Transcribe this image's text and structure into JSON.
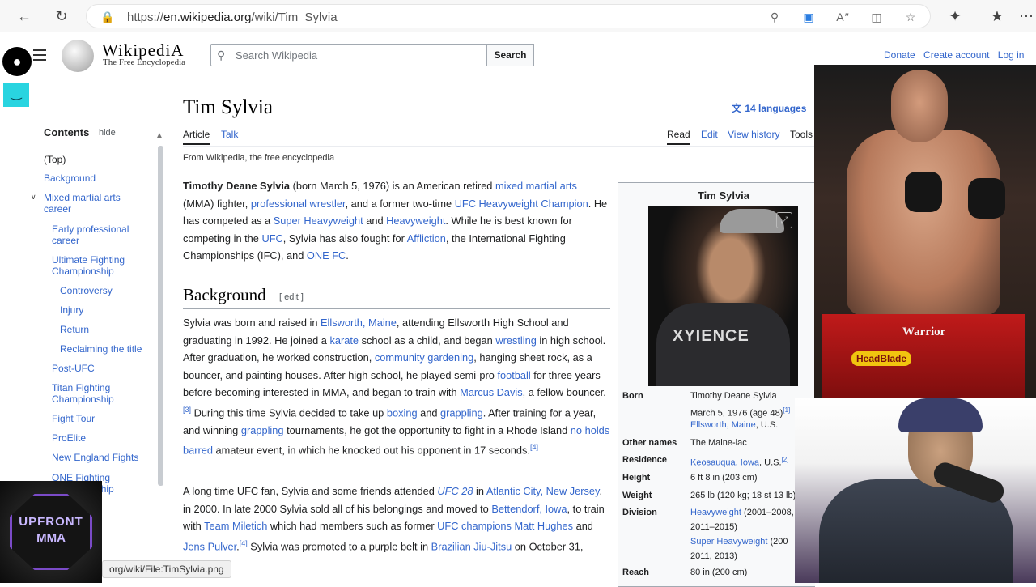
{
  "browser": {
    "url_prefix": "https://",
    "url_host": "en.wikipedia.org",
    "url_path": "/wiki/Tim_Sylvia"
  },
  "wiki": {
    "wordmark": "WikipediA",
    "tagline": "The Free Encyclopedia",
    "search_placeholder": "Search Wikipedia",
    "search_button": "Search",
    "donate": "Donate",
    "create_account": "Create account",
    "login": "Log in",
    "more": "••"
  },
  "toc": {
    "title": "Contents",
    "hide": "hide",
    "items": [
      "(Top)",
      "Background",
      "Mixed martial arts career",
      "Early professional career",
      "Ultimate Fighting Championship",
      "Controversy",
      "Injury",
      "Return",
      "Reclaiming the title",
      "Post-UFC",
      "Titan Fighting Championship",
      "Fight Tour",
      "ProElite",
      "New England Fights",
      "ONE Fighting Championship"
    ]
  },
  "article": {
    "title": "Tim Sylvia",
    "languages": "14 languages",
    "tabs": [
      "Article",
      "Talk"
    ],
    "actions": [
      "Read",
      "Edit",
      "View history",
      "Tools"
    ],
    "from": "From Wikipedia, the free encyclopedia",
    "bg_heading": "Background",
    "bg_edit": "[ edit ]"
  },
  "infobox": {
    "title": "Tim Sylvia",
    "born_label": "Born",
    "born_name": "Timothy Deane Sylvia",
    "born_date": "March 5, 1976 (age 48)",
    "born_ref": "[1]",
    "born_place": "Ellsworth, Maine",
    "born_place_suffix": ", U.S.",
    "other_label": "Other names",
    "other_val": "The Maine-iac",
    "res_label": "Residence",
    "res_link": "Keosauqua, Iowa",
    "res_suffix": ", U.S.",
    "res_ref": "[2]",
    "height_label": "Height",
    "height_val": "6 ft 8 in (203 cm)",
    "weight_label": "Weight",
    "weight_val": "265 lb (120 kg; 18 st 13 lb)",
    "div_label": "Division",
    "div_1": "Heavyweight",
    "div_1_years": " (2001–2008,",
    "div_1b": "2011–2015)",
    "div_2": "Super Heavyweight",
    "div_2_years": " (200",
    "div_2b": "2011, 2013)",
    "reach_label": "Reach",
    "reach_val": "80 in (200 cm)"
  },
  "overlays": {
    "warrior": "Warrior",
    "headblade": "HeadBlade",
    "upfront_1": "UPFRONT",
    "upfront_2": "MMA",
    "status_url": "org/wiki/File:TimSylvia.png"
  }
}
